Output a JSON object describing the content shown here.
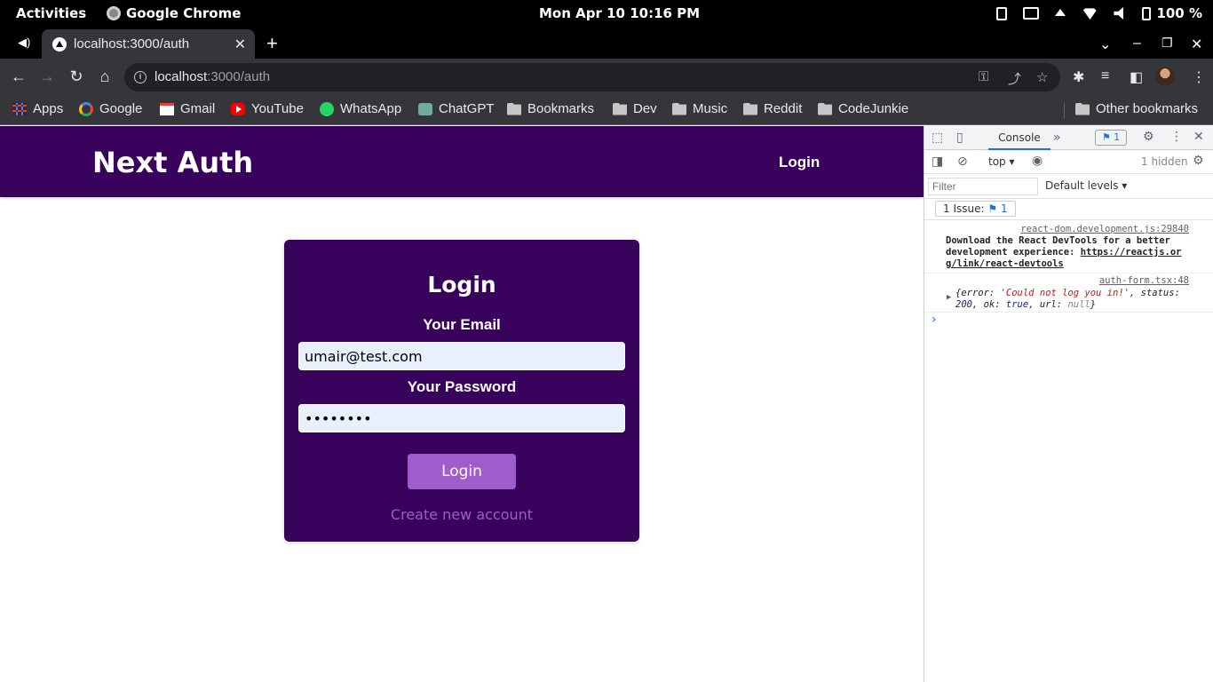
{
  "system_bar": {
    "activities": "Activities",
    "app_name": "Google Chrome",
    "clock": "Mon Apr 10  10:16 PM",
    "battery": "100 %"
  },
  "browser": {
    "tab": {
      "title": "localhost:3000/auth",
      "close": "✕"
    },
    "new_tab": "+",
    "omnibox": {
      "host": "localhost",
      "path": ":3000/auth"
    },
    "bookmarks": [
      {
        "label": "Apps",
        "icon": "apps-icon"
      },
      {
        "label": "Google",
        "icon": "google-icon"
      },
      {
        "label": "Gmail",
        "icon": "gmail-icon"
      },
      {
        "label": "YouTube",
        "icon": "youtube-icon"
      },
      {
        "label": "WhatsApp",
        "icon": "whatsapp-icon"
      },
      {
        "label": "ChatGPT",
        "icon": "chatgpt-icon"
      },
      {
        "label": "Bookmarks",
        "icon": "folder-icon"
      },
      {
        "label": "Dev",
        "icon": "folder-icon"
      },
      {
        "label": "Music",
        "icon": "folder-icon"
      },
      {
        "label": "Reddit",
        "icon": "folder-icon"
      },
      {
        "label": "CodeJunkie",
        "icon": "folder-icon"
      }
    ],
    "other_bookmarks": "Other bookmarks"
  },
  "site": {
    "logo": "Next Auth",
    "nav_login": "Login",
    "form": {
      "title": "Login",
      "email_label": "Your Email",
      "email_value": "umair@test.com",
      "password_label": "Your Password",
      "password_value": "••••••••",
      "submit": "Login",
      "toggle": "Create new account"
    }
  },
  "devtools": {
    "tab_console": "Console",
    "issues_badge": "1",
    "context": "top ▾",
    "hidden": "1 hidden",
    "filter_placeholder": "Filter",
    "levels": "Default levels ▾",
    "issue_chip_prefix": "1 Issue:",
    "issue_chip_count": "1",
    "messages": [
      {
        "source": "react-dom.development.js:29840",
        "line1": "Download the React DevTools for a better",
        "line2_prefix": "development experience: ",
        "link_part1": "https://reactjs.or",
        "link_part2": "g/link/react-devtools"
      },
      {
        "source": "auth-form.tsx:48",
        "obj_line1_prefix": "{error: ",
        "obj_error": "'Could not log you in!'",
        "obj_line1_suffix": ", status:",
        "obj_status": "200",
        "obj_ok_label": ", ok: ",
        "obj_ok": "true",
        "obj_url_label": ", url: ",
        "obj_url": "null",
        "obj_close": "}"
      }
    ]
  },
  "colors": {
    "brand": "#38015c",
    "accent": "#9f5ccc",
    "input_bg": "#e8f0fe"
  }
}
